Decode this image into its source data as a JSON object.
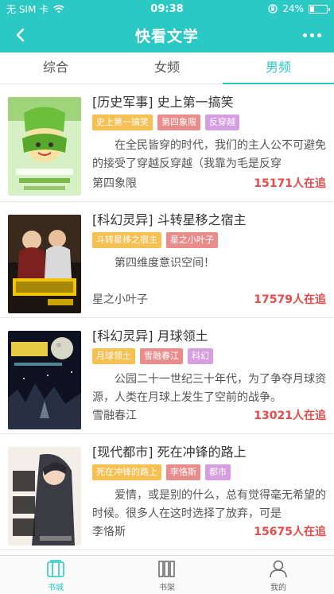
{
  "status_bar": {
    "carrier": "无 SIM 卡",
    "time": "09:38",
    "battery": "24%",
    "battery_level": 0.24
  },
  "nav": {
    "title": "快看文学",
    "back_icon": "back-arrow-icon",
    "more_icon": "more-dots-icon"
  },
  "tabs": [
    {
      "label": "综合",
      "active": false
    },
    {
      "label": "女频",
      "active": false
    },
    {
      "label": "男频",
      "active": true
    }
  ],
  "books": [
    {
      "title": "[历史军事] 史上第一搞笑",
      "tags": [
        "史上第一搞笑",
        "第四象限",
        "反穿越"
      ],
      "desc": "在全民皆穿的时代，我们的主人公不可避免的接受了穿越反穿越（我靠为毛是反穿",
      "author": "第四象限",
      "readers": "15171人在追"
    },
    {
      "title": "[科幻灵异] 斗转星移之宿主",
      "tags": [
        "斗转星移之宿主",
        "星之小叶子"
      ],
      "desc": "第四维度意识空间！",
      "author": "星之小叶子",
      "readers": "17579人在追"
    },
    {
      "title": "[科幻灵异] 月球领土",
      "tags": [
        "月球领土",
        "雪融春江",
        "科幻"
      ],
      "desc": "公园二十一世纪三十年代，为了争夺月球资源，人类在月球上发生了空前的战争。",
      "author": "雪融春江",
      "readers": "13021人在追"
    },
    {
      "title": "[现代都市] 死在冲锋的路上",
      "tags": [
        "死在冲锋的路上",
        "李恪斯",
        "都市"
      ],
      "desc": "爱情，或是别的什么，总有觉得毫无希望的时候。很多人在这时选择了放弃，可是",
      "author": "李恪斯",
      "readers": "15675人在追"
    }
  ],
  "bottom_nav": [
    {
      "label": "书城",
      "icon": "bookstore-icon",
      "active": true
    },
    {
      "label": "书架",
      "icon": "bookshelf-icon",
      "active": false
    },
    {
      "label": "我的",
      "icon": "profile-icon",
      "active": false
    }
  ],
  "colors": {
    "accent": "#2bc8c4",
    "reader_count": "#e84a4a",
    "tag_yellow": "#f7c052",
    "tag_red": "#e88c8c",
    "tag_purple": "#d59ee0"
  }
}
